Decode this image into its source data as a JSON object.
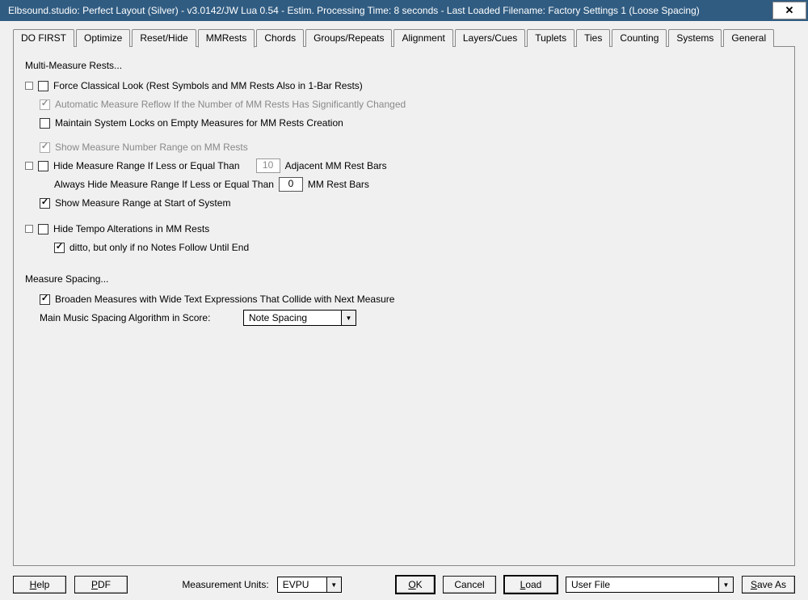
{
  "title": "Elbsound.studio: Perfect Layout (Silver) - v3.0142/JW Lua 0.54 - Estim. Processing Time: 8 seconds - Last Loaded Filename: Factory Settings 1 (Loose Spacing)",
  "tabs": [
    {
      "label": "DO FIRST"
    },
    {
      "label": "Optimize"
    },
    {
      "label": "Reset/Hide"
    },
    {
      "label": "MMRests"
    },
    {
      "label": "Chords"
    },
    {
      "label": "Groups/Repeats"
    },
    {
      "label": "Alignment"
    },
    {
      "label": "Layers/Cues"
    },
    {
      "label": "Tuplets"
    },
    {
      "label": "Ties"
    },
    {
      "label": "Counting"
    },
    {
      "label": "Systems"
    },
    {
      "label": "General"
    }
  ],
  "active_tab": "MMRests",
  "sections": {
    "mm_heading": "Multi-Measure Rests...",
    "spacing_heading": "Measure Spacing..."
  },
  "options": {
    "force_classical": "Force Classical Look (Rest Symbols and MM Rests Also in 1-Bar Rests)",
    "auto_reflow": "Automatic Measure Reflow If the Number of MM Rests Has Significantly Changed",
    "maintain_locks": "Maintain System Locks on Empty Measures for MM Rests Creation",
    "show_range": "Show Measure Number Range on MM Rests",
    "hide_range_if_leq": "Hide Measure Range If Less or Equal Than",
    "hide_range_if_leq_value": "10",
    "hide_range_if_leq_suffix": "Adjacent MM Rest Bars",
    "always_hide_if_leq": "Always Hide Measure Range If Less or Equal Than",
    "always_hide_value": "0",
    "always_hide_suffix": "MM Rest Bars",
    "show_range_start": "Show Measure Range at Start of System",
    "hide_tempo": "Hide Tempo Alterations in MM Rests",
    "ditto_only": "ditto, but only if no Notes Follow Until End",
    "broaden": "Broaden Measures with Wide Text Expressions That Collide with Next Measure",
    "algo_label": "Main Music Spacing Algorithm in Score:",
    "algo_value": "Note Spacing"
  },
  "footer": {
    "help": "Help",
    "pdf": "PDF",
    "mu_label": "Measurement Units:",
    "mu_value": "EVPU",
    "ok": "OK",
    "cancel": "Cancel",
    "load": "Load",
    "file_value": "User File",
    "save_as": "Save As"
  }
}
